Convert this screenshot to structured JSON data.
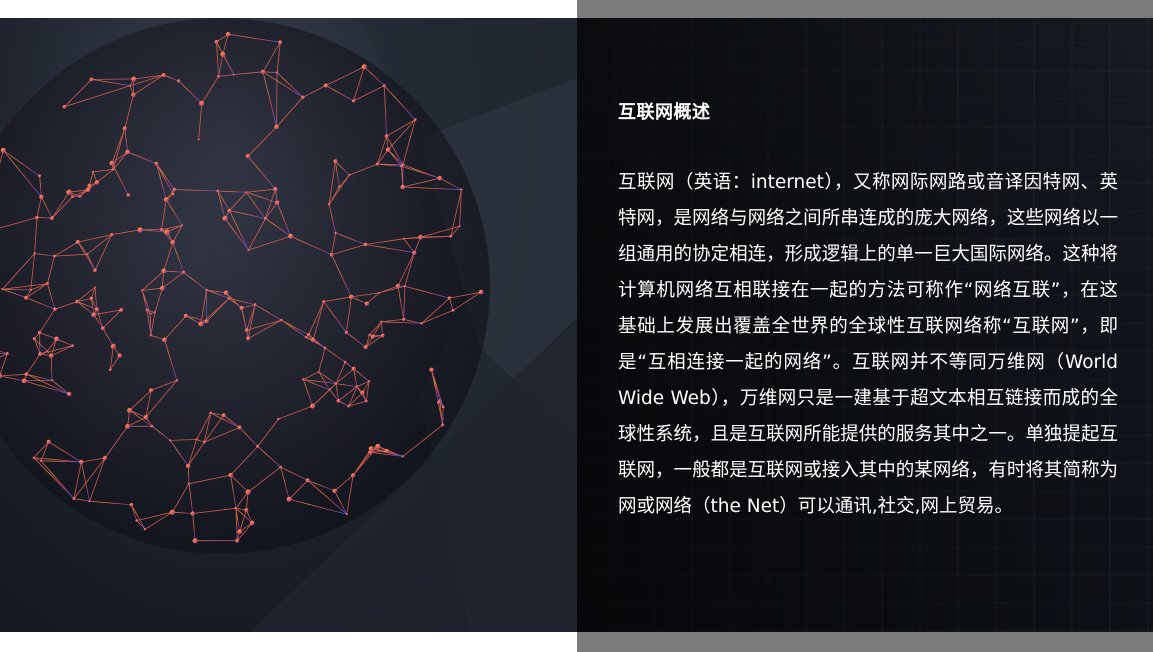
{
  "article": {
    "title": "互联网概述",
    "body": "互联网（英语：internet），又称网际网路或音译因特网、英特网，是网络与网络之间所串连成的庞大网络，这些网络以一组通用的协定相连，形成逻辑上的单一巨大国际网络。这种将计算机网络互相联接在一起的方法可称作“网络互联”，在这基础上发展出覆盖全世界的全球性互联网络称“互联网”，即是“互相连接一起的网络”。互联网并不等同万维网（World Wide Web），万维网只是一建基于超文本相互链接而成的全球性系统，且是互联网所能提供的服务其中之一。单独提起互联网，一般都是互联网或接入其中的某网络，有时将其简称为网或网络（the Net）可以通讯,社交,网上贸易。"
  },
  "theme": {
    "background": "#ffffff",
    "bar_gray": "#7b7b7b",
    "text_color": "#ffffff",
    "globe_colors": [
      "#f08a3c",
      "#e8506a",
      "#b04f9a",
      "#4a6ad6"
    ]
  },
  "images": {
    "left": "network-globe-illustration",
    "right": "dark-city-building-background"
  }
}
